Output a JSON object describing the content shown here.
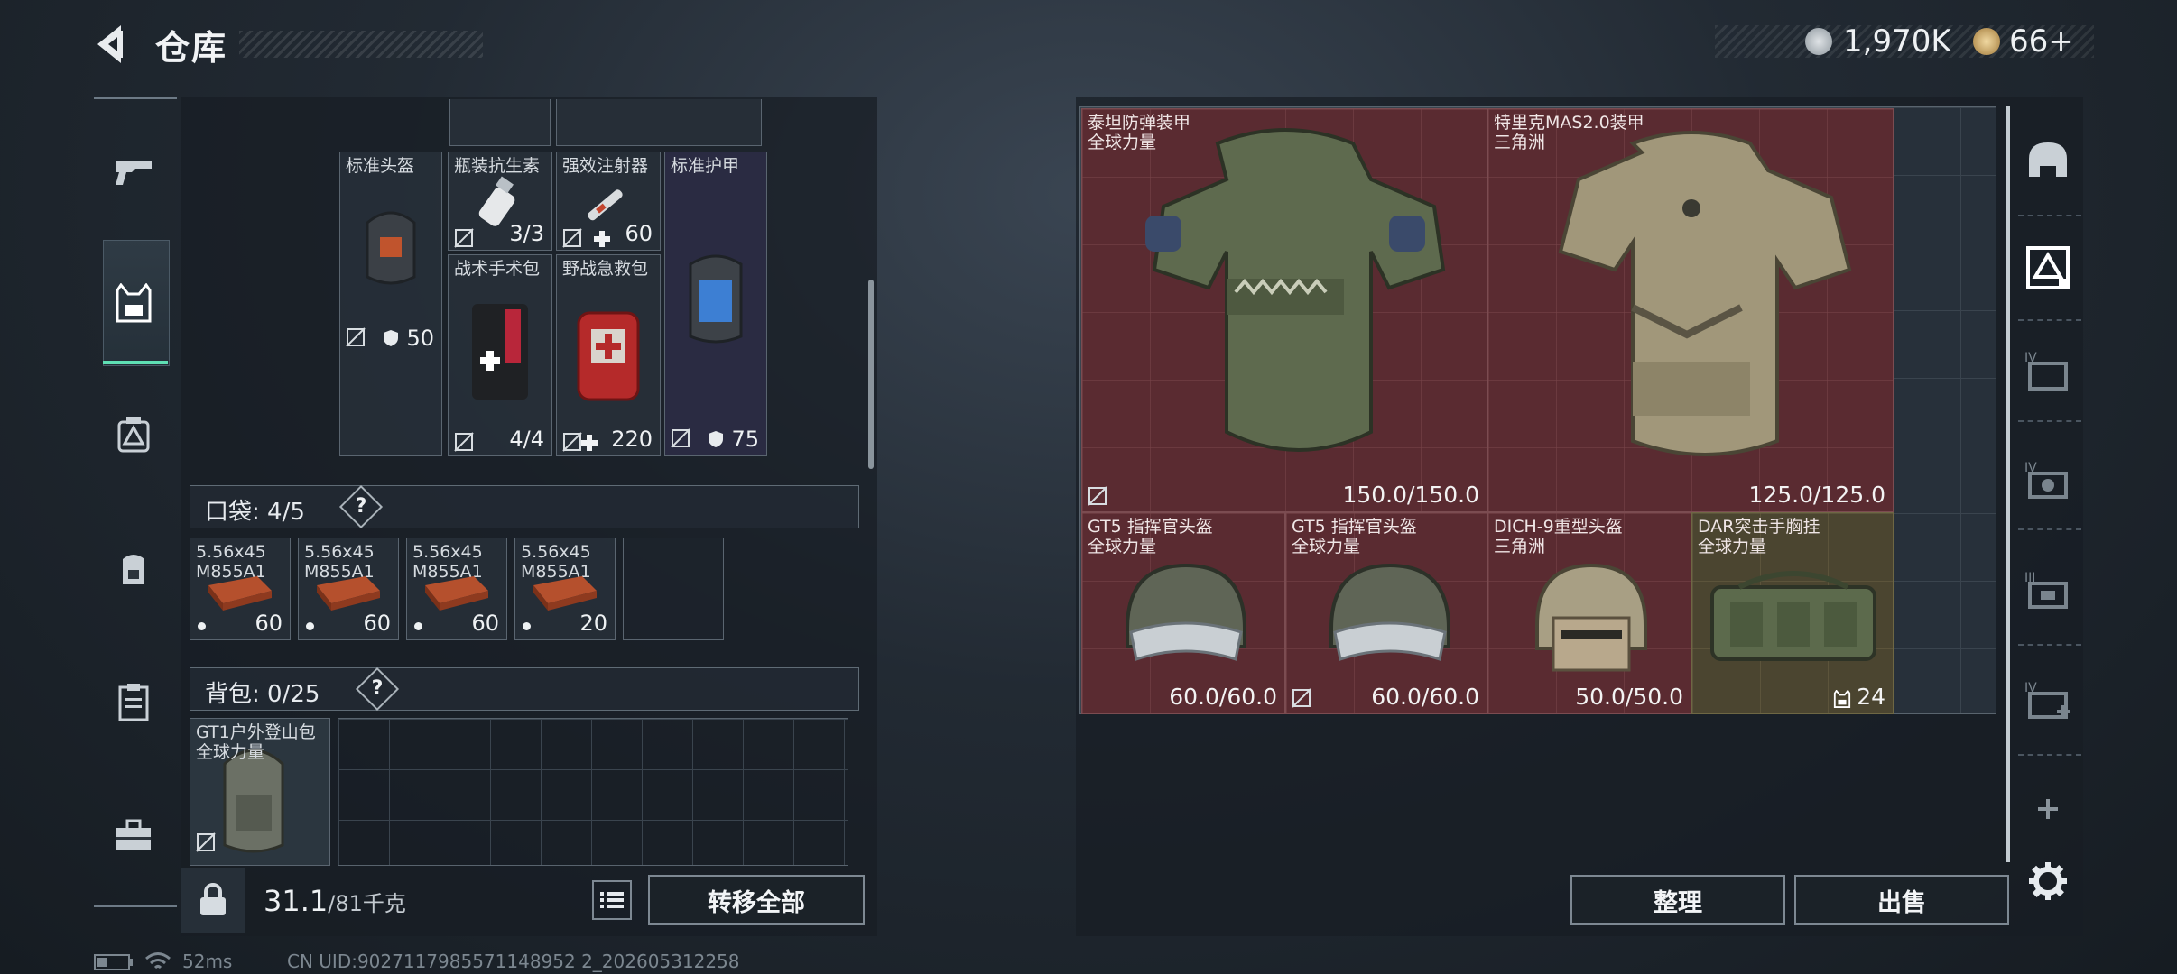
{
  "header": {
    "title": "仓库",
    "silver": "1,970K",
    "gold": "66+"
  },
  "left": {
    "top_items": [
      {
        "name": "标准头盔",
        "value": "50"
      },
      {
        "name": "瓶装抗生素",
        "value": "3/3"
      },
      {
        "name": "强效注射器",
        "value": "60"
      },
      {
        "name": "标准护甲",
        "value": "75"
      },
      {
        "name": "战术手术包",
        "value": "4/4"
      },
      {
        "name": "野战急救包",
        "value": "220"
      }
    ],
    "pocket": {
      "label": "口袋:",
      "count": "4/5",
      "help": "?"
    },
    "ammo": [
      {
        "name": "5.56x45\nM855A1",
        "value": "60"
      },
      {
        "name": "5.56x45\nM855A1",
        "value": "60"
      },
      {
        "name": "5.56x45\nM855A1",
        "value": "60"
      },
      {
        "name": "5.56x45\nM855A1",
        "value": "20"
      }
    ],
    "backpack": {
      "label": "背包:",
      "count": "0/25",
      "help": "?",
      "item": "GT1户外登山包\n全球力量"
    },
    "weight": {
      "current": "31.1",
      "max": "/81千克"
    },
    "transfer_label": "转移全部"
  },
  "right": {
    "items": [
      {
        "name": "泰坦防弹装甲\n全球力量",
        "dur": "150.0/150.0"
      },
      {
        "name": "特里克MAS2.0装甲\n三角洲",
        "dur": "125.0/125.0"
      },
      {
        "name": "GT5 指挥官头盔\n全球力量",
        "dur": "60.0/60.0"
      },
      {
        "name": "GT5 指挥官头盔\n全球力量",
        "dur": "60.0/60.0"
      },
      {
        "name": "DICH-9重型头盔\n三角洲",
        "dur": "50.0/50.0"
      },
      {
        "name": "DAR突击手胸挂\n全球力量",
        "dur": "24"
      }
    ],
    "sort_label": "整理",
    "sell_label": "出售"
  },
  "status": {
    "ping": "52ms",
    "uid": "CN UID:9027117985571148952 2_202605312258"
  }
}
